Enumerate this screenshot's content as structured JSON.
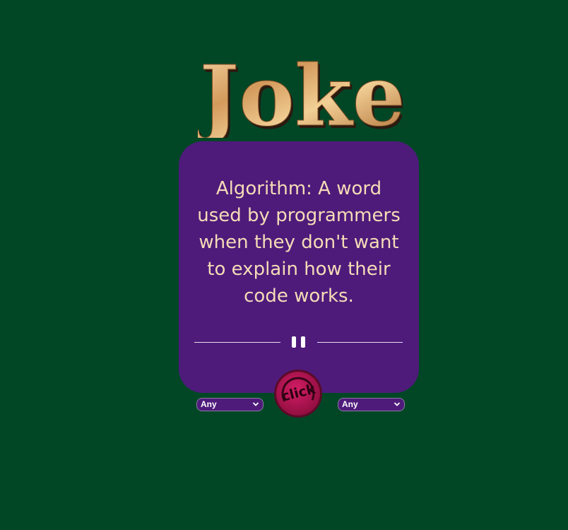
{
  "logo": {
    "text": "Joke"
  },
  "joke": {
    "text": "Algorithm: A word used by programmers when they don't want to explain how their code works."
  },
  "controls": {
    "click_label": "click",
    "category_select": {
      "selected": "Any"
    },
    "type_select": {
      "selected": "Any"
    }
  },
  "colors": {
    "background": "#014726",
    "card": "#4e1b7b",
    "joke_text": "#f5dcb7",
    "click_button": "#c0165a",
    "logo_gold": "#d9a464"
  }
}
